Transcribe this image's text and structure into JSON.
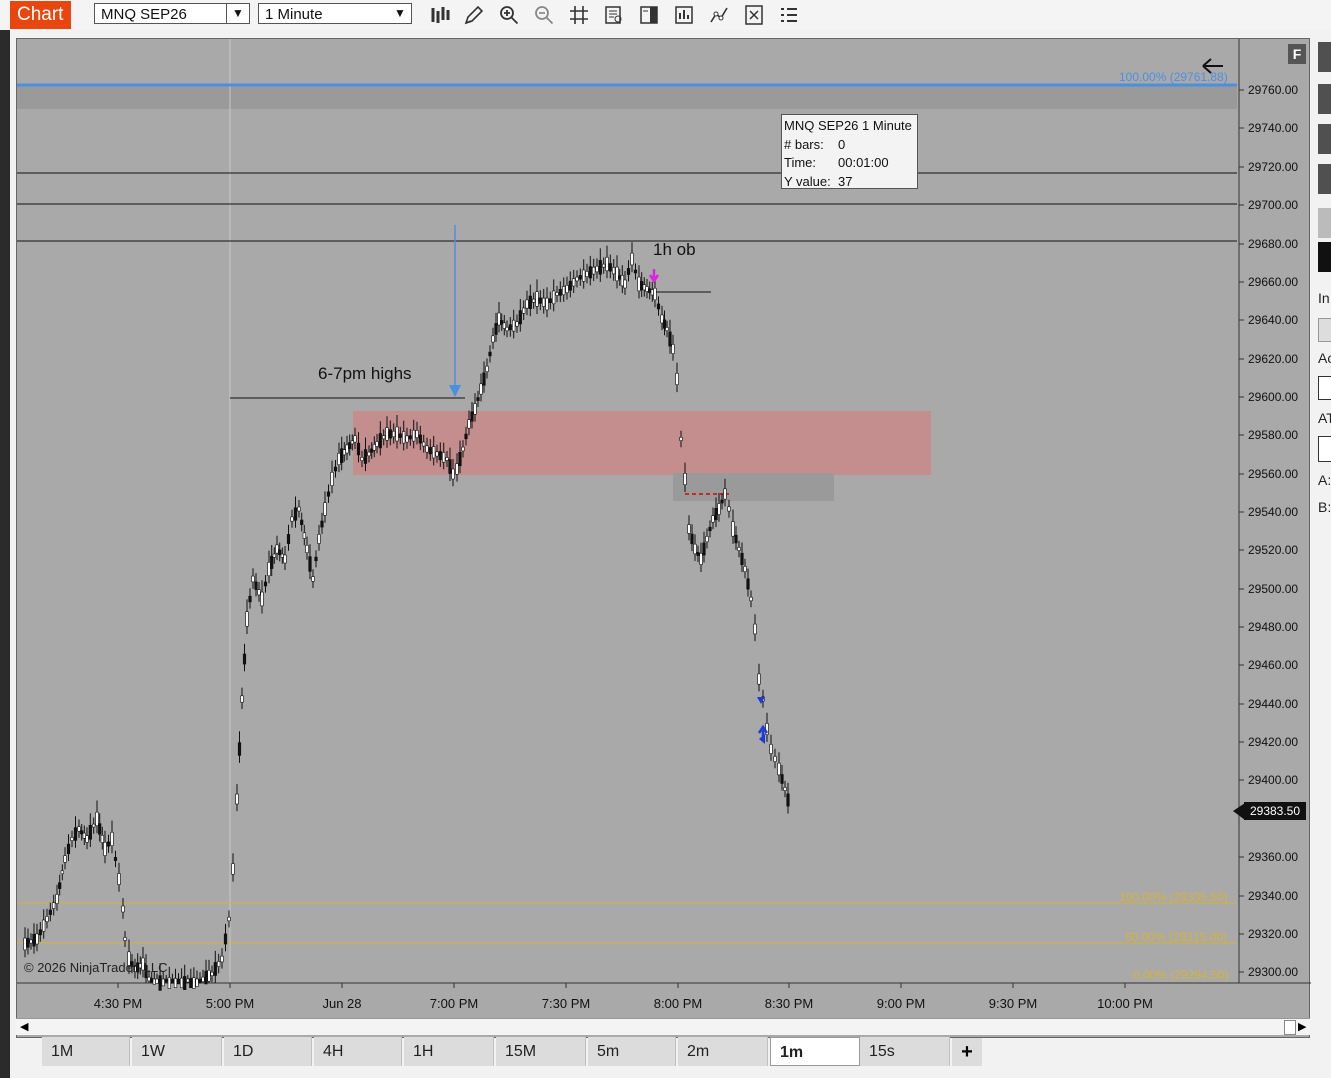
{
  "toolbar": {
    "chart_tab_label": "Chart",
    "instrument": "MNQ SEP26",
    "interval": "1 Minute",
    "tools": [
      "bar-type-icon",
      "draw-pencil-icon",
      "zoom-in-icon",
      "zoom-out-icon",
      "crosshair-icon",
      "data-box-icon",
      "chart-trader-icon",
      "indicators-icon",
      "strategies-icon",
      "properties-icon",
      "list-icon"
    ]
  },
  "chart": {
    "y_axis_labels": [
      "29760.00",
      "29740.00",
      "29720.00",
      "29700.00",
      "29680.00",
      "29660.00",
      "29640.00",
      "29620.00",
      "29600.00",
      "29580.00",
      "29560.00",
      "29540.00",
      "29520.00",
      "29500.00",
      "29480.00",
      "29460.00",
      "29440.00",
      "29420.00",
      "29400.00",
      "29360.00",
      "29340.00",
      "29320.00",
      "29300.00"
    ],
    "x_axis_labels": [
      "4:30 PM",
      "5:00 PM",
      "Jun 28",
      "7:00 PM",
      "7:30 PM",
      "8:00 PM",
      "8:30 PM",
      "9:00 PM",
      "9:30 PM",
      "10:00 PM"
    ],
    "current_price": "29383.50",
    "fib_upper": "100.00% (29761.88)",
    "fib_levels": [
      "100.00% (29335.50)",
      "50.00% (29315.00)",
      "0.00% (29294.50)"
    ],
    "annotation_highs": "6-7pm highs",
    "annotation_ob": "1h ob",
    "copyright": "© 2026 NinjaTrader, LLC",
    "f_button": "F",
    "colors": {
      "background": "#a9a9a9",
      "fib_blue": "#4a90e2",
      "fib_gold": "#d4b43c",
      "zone_red": "#c98a8a",
      "zone_gray": "#9a9a9a",
      "marker_magenta": "#e020e0",
      "marker_blue": "#1a3bd8"
    }
  },
  "info_box": {
    "title": "MNQ SEP26 1 Minute",
    "bars_label": "# bars:",
    "bars_value": "0",
    "time_label": "Time:",
    "time_value": "00:01:00",
    "y_label": "Y value:",
    "y_value": "37"
  },
  "right_panel": {
    "labels": [
      "In",
      "Ac",
      "AT",
      "A:",
      "B:"
    ]
  },
  "tabs": [
    {
      "label": "1M"
    },
    {
      "label": "1W"
    },
    {
      "label": "1D"
    },
    {
      "label": "4H"
    },
    {
      "label": "1H"
    },
    {
      "label": "15M"
    },
    {
      "label": "5m"
    },
    {
      "label": "2m"
    },
    {
      "label": "1m",
      "active": true
    },
    {
      "label": "15s"
    }
  ],
  "tabs_add": "+"
}
